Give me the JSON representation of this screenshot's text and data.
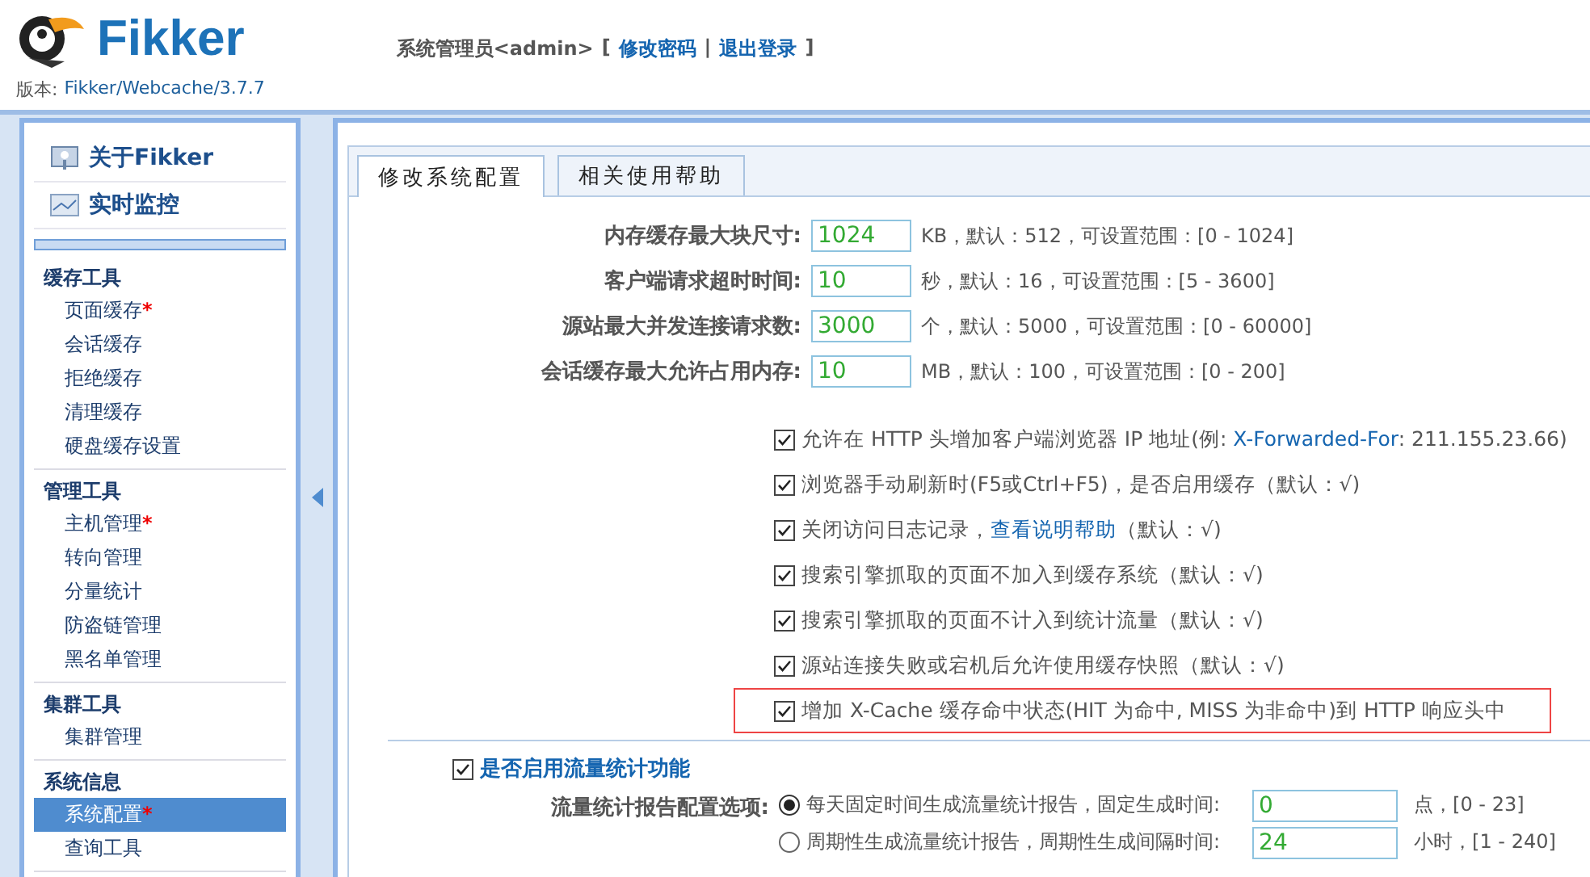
{
  "header": {
    "brand": "Fikker",
    "user": "系统管理员<admin>",
    "open_bracket": "[",
    "links": [
      "修改密码",
      "退出登录"
    ],
    "separator": "|",
    "close_bracket": "]",
    "version_label": "版本:",
    "version": "Fikker/Webcache/3.7.7"
  },
  "sidebar": {
    "top_links": [
      {
        "kind": "about",
        "label": "关于Fikker"
      },
      {
        "kind": "monitor",
        "label": "实时监控"
      }
    ],
    "groups": [
      {
        "title": "缓存工具",
        "items": [
          {
            "label": "页面缓存",
            "star": "*",
            "selected": false
          },
          {
            "label": "会话缓存",
            "selected": false
          },
          {
            "label": "拒绝缓存",
            "selected": false
          },
          {
            "label": "清理缓存",
            "selected": false
          },
          {
            "label": "硬盘缓存设置",
            "selected": false
          }
        ]
      },
      {
        "title": "管理工具",
        "items": [
          {
            "label": "主机管理",
            "star": "*",
            "selected": false
          },
          {
            "label": "转向管理",
            "selected": false
          },
          {
            "label": "分量统计",
            "selected": false
          },
          {
            "label": "防盗链管理",
            "selected": false
          },
          {
            "label": "黑名单管理",
            "selected": false
          }
        ]
      },
      {
        "title": "集群工具",
        "items": [
          {
            "label": "集群管理",
            "selected": false
          }
        ]
      },
      {
        "title": "系统信息",
        "items": [
          {
            "label": "系统配置",
            "star": "*",
            "selected": true
          },
          {
            "label": "查询工具",
            "selected": false
          }
        ]
      }
    ]
  },
  "tabs": [
    {
      "label": "修改系统配置",
      "selected": true
    },
    {
      "label": "相关使用帮助",
      "selected": false
    }
  ],
  "settings": [
    {
      "label": "内存缓存最大块尺寸:",
      "value": "1024",
      "hint": "KB，默认：512，可设置范围：[0 - 1024]"
    },
    {
      "label": "客户端请求超时时间:",
      "value": "10",
      "hint": "秒，默认：16，可设置范围：[5 - 3600]"
    },
    {
      "label": "源站最大并发连接请求数:",
      "value": "3000",
      "hint": "个，默认：5000，可设置范围：[0 - 60000]"
    },
    {
      "label": "会话缓存最大允许占用内存:",
      "value": "10",
      "hint": "MB，默认：100，可设置范围：[0 - 200]"
    }
  ],
  "options": [
    {
      "checked": true,
      "text": "允许在 HTTP 头增加客户端浏览器 IP 地址(例: ",
      "link": "X-Forwarded-For",
      "after": ": 211.155.23.66)",
      "highlighted": false
    },
    {
      "checked": true,
      "text": "浏览器手动刷新时(F5或Ctrl+F5)，是否启用缓存（默认：√)",
      "highlighted": false
    },
    {
      "checked": true,
      "text": "关闭访问日志记录，",
      "link": "查看说明帮助",
      "after": "（默认：√)",
      "highlighted": false
    },
    {
      "checked": true,
      "text": "搜索引擎抓取的页面不加入到缓存系统（默认：√)",
      "highlighted": false
    },
    {
      "checked": true,
      "text": "搜索引擎抓取的页面不计入到统计流量（默认：√)",
      "highlighted": false
    },
    {
      "checked": true,
      "text": "源站连接失败或宕机后允许使用缓存快照（默认：√)",
      "highlighted": false
    },
    {
      "checked": true,
      "text": "增加 X-Cache 缓存命中状态(HIT 为命中, MISS 为非命中)到 HTTP 响应头中",
      "highlighted": true
    }
  ],
  "traffic": {
    "checked": true,
    "label": "是否启用流量统计功能",
    "report_label": "流量统计报告配置选项:",
    "choices": [
      {
        "selected": true,
        "text": "每天固定时间生成流量统计报告，固定生成时间:",
        "value": "0",
        "unit": "点，[0 - 23]"
      },
      {
        "selected": false,
        "text": "周期性生成流量统计报告，周期性生成间隔时间:",
        "value": "24",
        "unit": "小时，[1 - 240]"
      }
    ]
  }
}
